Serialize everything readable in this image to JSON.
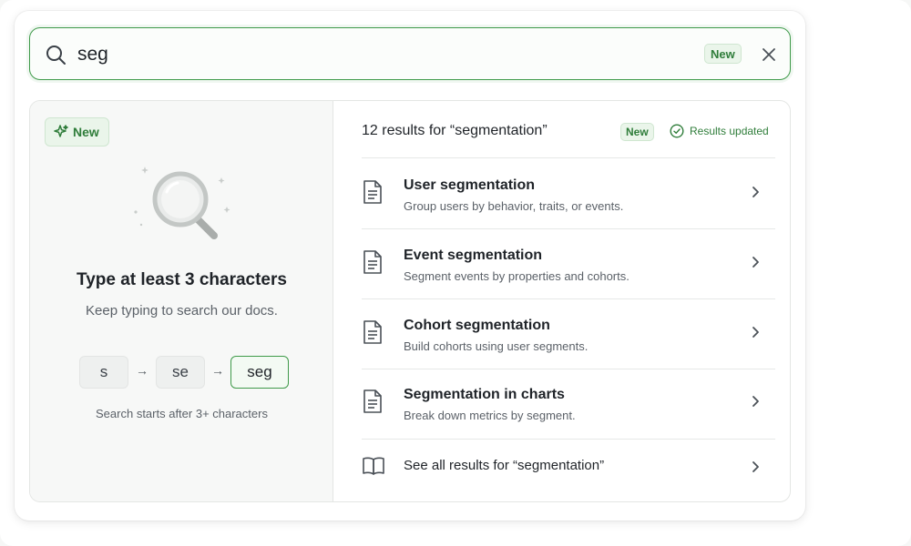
{
  "search": {
    "value": "seg",
    "badge": "New"
  },
  "empty_state": {
    "badge": "New",
    "title": "Type at least 3 characters",
    "subtitle": "Keep typing to search our docs.",
    "steps": [
      "s",
      "se",
      "seg"
    ],
    "arrow": "→",
    "caption": "Search starts after 3+ characters"
  },
  "results": {
    "heading": "12 results for “segmentation”",
    "badge": "New",
    "status": "Results updated",
    "items": [
      {
        "title": "User segmentation",
        "description": "Group users by behavior, traits, or events.",
        "icon": "document-icon"
      },
      {
        "title": "Event segmentation",
        "description": "Segment events by properties and cohorts.",
        "icon": "document-icon"
      },
      {
        "title": "Cohort segmentation",
        "description": "Build cohorts using user segments.",
        "icon": "document-icon"
      },
      {
        "title": "Segmentation in charts",
        "description": "Break down metrics by segment.",
        "icon": "document-icon"
      }
    ],
    "see_all": "See all results for “segmentation”"
  },
  "colors": {
    "accent": "#3f9a4a",
    "badge_bg": "#eaf5ea",
    "badge_text": "#2f7d3a"
  }
}
